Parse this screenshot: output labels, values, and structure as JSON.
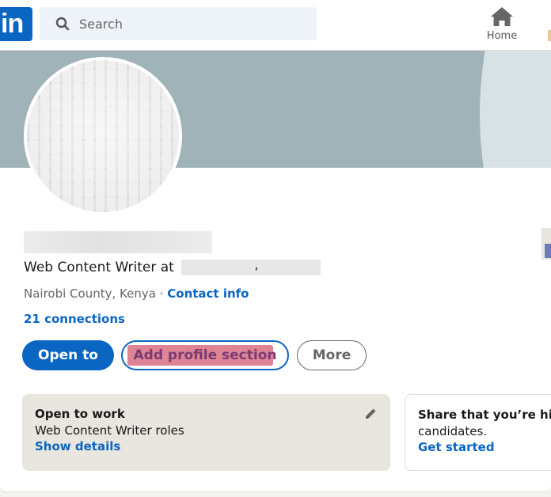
{
  "topbar": {
    "logo_text": "in",
    "search": {
      "placeholder": "Search",
      "value": ""
    },
    "nav": [
      {
        "label": "Home",
        "icon": "home-icon"
      }
    ]
  },
  "profile": {
    "name": "",
    "headline_prefix": "Web Content Writer at",
    "location": "Nairobi County, Kenya",
    "separator": "·",
    "contact_info_label": "Contact info",
    "connections_label": "21 connections"
  },
  "actions": {
    "open_to_label": "Open to",
    "add_section_label": "Add profile section",
    "more_label": "More"
  },
  "open_to_work": {
    "title": "Open to work",
    "subtitle": "Web Content Writer roles",
    "link": "Show details",
    "icon": "pencil-icon"
  },
  "hiring": {
    "title": "Share that you’re hiring and attract qualified",
    "subtitle": "candidates.",
    "link": "Get started"
  },
  "colors": {
    "brand": "#0a66c2",
    "banner": "#a0b3b8",
    "highlight": "#df8494",
    "open_to_work_bg": "#e9e5df"
  }
}
